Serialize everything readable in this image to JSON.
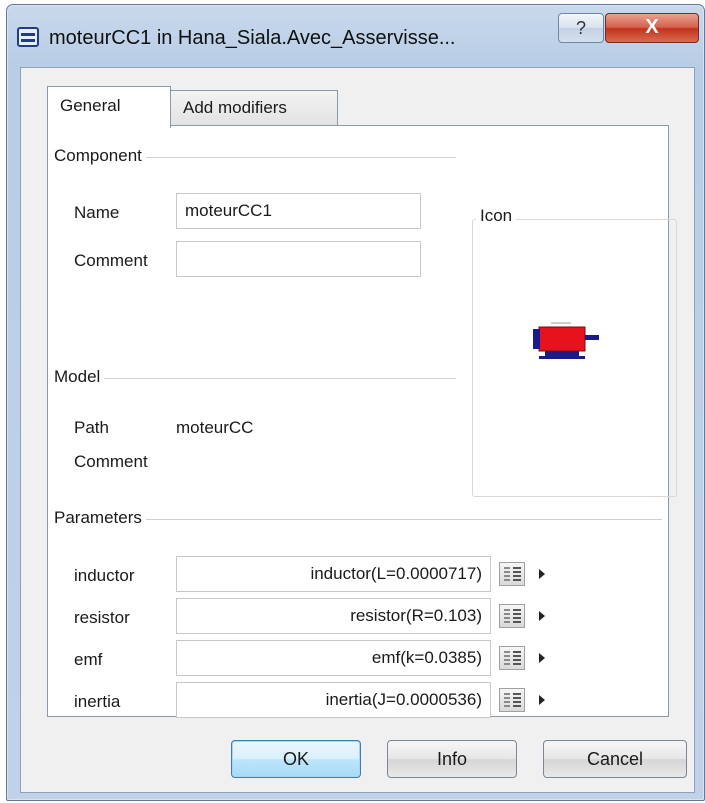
{
  "window": {
    "title": "moteurCC1 in Hana_Siala.Avec_Asservisse...",
    "help_label": "?",
    "close_label": "X"
  },
  "tabs": [
    {
      "label": "General",
      "active": true
    },
    {
      "label": "Add modifiers",
      "active": false
    }
  ],
  "component": {
    "group_title": "Component",
    "name_label": "Name",
    "name_value": "moteurCC1",
    "comment_label": "Comment",
    "comment_value": ""
  },
  "icon_group": {
    "title": "Icon",
    "icon": "dc-motor-icon"
  },
  "model": {
    "group_title": "Model",
    "path_label": "Path",
    "path_value": "moteurCC",
    "comment_label": "Comment"
  },
  "parameters": {
    "group_title": "Parameters",
    "rows": [
      {
        "label": "inductor",
        "value": "inductor(L=0.0000717)"
      },
      {
        "label": "resistor",
        "value": "resistor(R=0.103)"
      },
      {
        "label": "emf",
        "value": "emf(k=0.0385)"
      },
      {
        "label": "inertia",
        "value": "inertia(J=0.0000536)"
      }
    ]
  },
  "buttons": {
    "ok": "OK",
    "info": "Info",
    "cancel": "Cancel"
  },
  "colors": {
    "motor_body": "#e8121c",
    "motor_base": "#1a1a8c",
    "default_button": "#bee6fd"
  }
}
